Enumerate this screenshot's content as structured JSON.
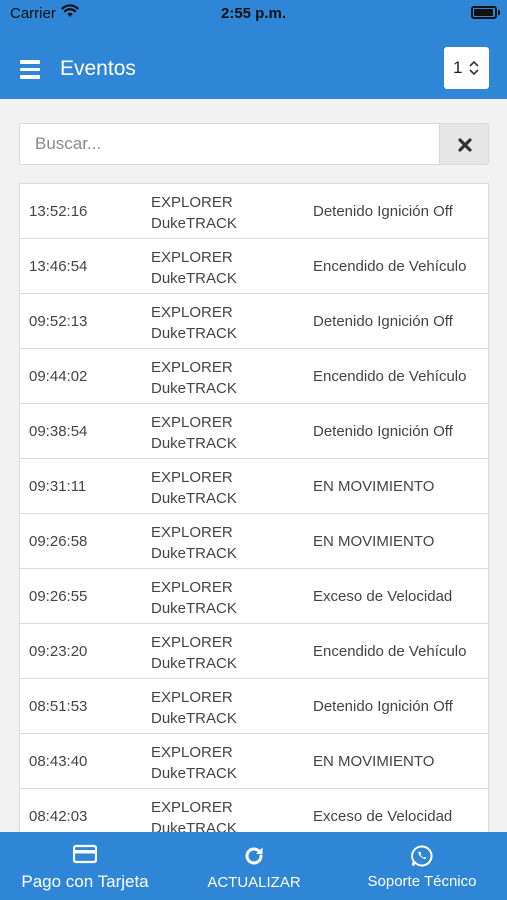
{
  "status_bar": {
    "carrier": "Carrier",
    "time": "2:55 p.m."
  },
  "header": {
    "title": "Eventos",
    "page_select": "1"
  },
  "search": {
    "placeholder": "Buscar..."
  },
  "events": [
    {
      "time": "13:52:16",
      "vehicle_line1": "EXPLORER",
      "vehicle_line2": "DukeTRACK",
      "event": "Detenido Ignición Off"
    },
    {
      "time": "13:46:54",
      "vehicle_line1": "EXPLORER",
      "vehicle_line2": "DukeTRACK",
      "event": "Encendido de Vehículo"
    },
    {
      "time": "09:52:13",
      "vehicle_line1": "EXPLORER",
      "vehicle_line2": "DukeTRACK",
      "event": "Detenido Ignición Off"
    },
    {
      "time": "09:44:02",
      "vehicle_line1": "EXPLORER",
      "vehicle_line2": "DukeTRACK",
      "event": "Encendido de Vehículo"
    },
    {
      "time": "09:38:54",
      "vehicle_line1": "EXPLORER",
      "vehicle_line2": "DukeTRACK",
      "event": "Detenido Ignición Off"
    },
    {
      "time": "09:31:11",
      "vehicle_line1": "EXPLORER",
      "vehicle_line2": "DukeTRACK",
      "event": "EN MOVIMIENTO"
    },
    {
      "time": "09:26:58",
      "vehicle_line1": "EXPLORER",
      "vehicle_line2": "DukeTRACK",
      "event": "EN MOVIMIENTO"
    },
    {
      "time": "09:26:55",
      "vehicle_line1": "EXPLORER",
      "vehicle_line2": "DukeTRACK",
      "event": "Exceso de Velocidad"
    },
    {
      "time": "09:23:20",
      "vehicle_line1": "EXPLORER",
      "vehicle_line2": "DukeTRACK",
      "event": "Encendido de Vehículo"
    },
    {
      "time": "08:51:53",
      "vehicle_line1": "EXPLORER",
      "vehicle_line2": "DukeTRACK",
      "event": "Detenido Ignición Off"
    },
    {
      "time": "08:43:40",
      "vehicle_line1": "EXPLORER",
      "vehicle_line2": "DukeTRACK",
      "event": "EN MOVIMIENTO"
    },
    {
      "time": "08:42:03",
      "vehicle_line1": "EXPLORER",
      "vehicle_line2": "DukeTRACK",
      "event": "Exceso de Velocidad"
    }
  ],
  "bottom_bar": {
    "payment_label": "Pago con Tarjeta",
    "refresh_label": "ACTUALIZAR",
    "support_label": "Soporte Técnico"
  },
  "icons": {
    "menu": "hamburger-menu-icon",
    "wifi": "wifi-icon",
    "battery": "battery-icon",
    "select_arrows": "up-down-chevron-icon",
    "clear": "close-x-icon",
    "payment": "credit-card-icon",
    "refresh": "refresh-icon",
    "support": "whatsapp-icon"
  },
  "colors": {
    "primary": "#2f86d6",
    "background": "#f2f2f2",
    "row_text": "#444444"
  }
}
